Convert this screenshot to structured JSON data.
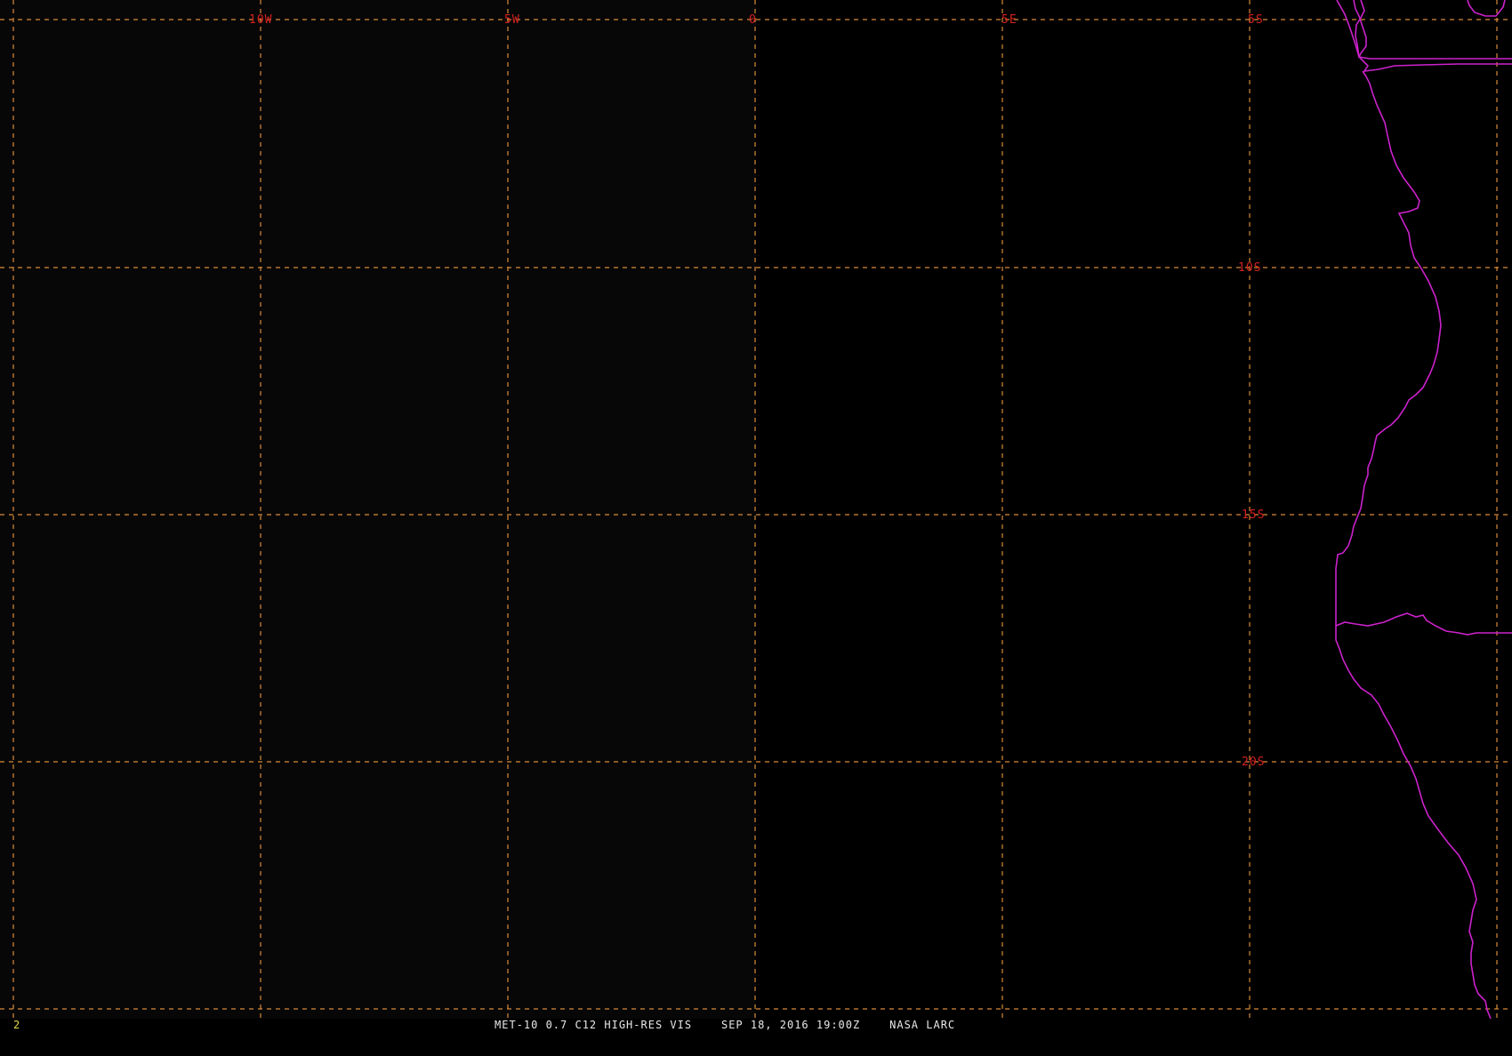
{
  "window_title": "MET-10 0.7 C12 HIGH-RES VIS",
  "colors": {
    "background": "#000000",
    "grid": "#d98a3a",
    "grid_labels": "#d42020",
    "coastline": "#cc22cc",
    "frame_number": "#e6d84a",
    "caption_text": "#e8e8e8"
  },
  "grid": {
    "style": "dashed",
    "longitude_labels": [
      {
        "id": "lon-10w",
        "text": "10W"
      },
      {
        "id": "lon-5w",
        "text": "5W"
      },
      {
        "id": "lon-0",
        "text": "0"
      },
      {
        "id": "lon-5e",
        "text": "5E"
      }
    ],
    "latitude_labels": [
      {
        "id": "lat-5s",
        "text": "5S"
      },
      {
        "id": "lat-10s",
        "text": "10S"
      },
      {
        "id": "lat-15s",
        "text": "15S"
      },
      {
        "id": "lat-20s",
        "text": "20S"
      }
    ]
  },
  "footer": {
    "frame_number": "2",
    "caption": "MET-10 0.7 C12 HIGH-RES VIS    SEP 18, 2016 19:00Z    NASA LARC"
  },
  "map_features": [
    "coastline",
    "country-borders",
    "lat-lon-grid"
  ]
}
